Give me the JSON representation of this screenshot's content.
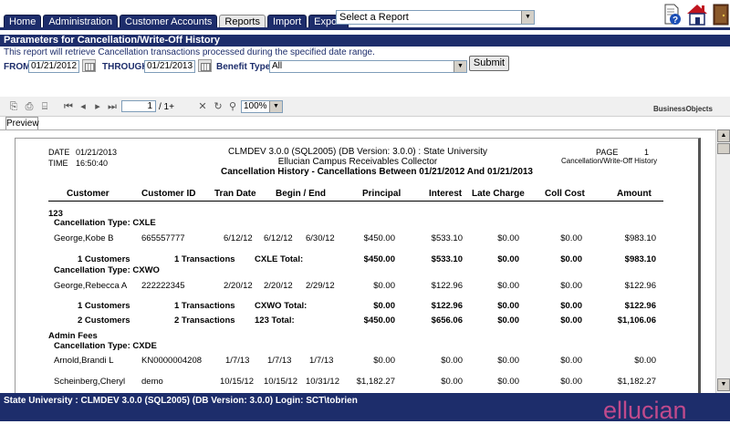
{
  "tabs": [
    "Home",
    "Administration",
    "Customer Accounts",
    "Reports",
    "Import",
    "Export"
  ],
  "active_tab": "Reports",
  "report_select": {
    "value": "Select a Report"
  },
  "icons": {
    "help": "help-icon",
    "home": "home-icon",
    "exit": "exit-door-icon"
  },
  "params": {
    "title": "Parameters for Cancellation/Write-Off History",
    "description": "This report will retrieve Cancellation transactions processed during the specified date range.",
    "from_label": "FROM:",
    "from_value": "01/21/2012",
    "through_label": "THROUGH:",
    "through_value": "01/21/2013",
    "benefit_label": "Benefit Type:",
    "benefit_value": "All",
    "submit": "Submit"
  },
  "viewer": {
    "page_number": "1",
    "page_of": "/ 1+",
    "zoom": "100%",
    "logo": "BusinessObjects",
    "preview_tab": "Preview"
  },
  "report": {
    "date_label": "DATE",
    "date_value": "01/21/2013",
    "time_label": "TIME",
    "time_value": "16:50:40",
    "line1": "CLMDEV 3.0.0 (SQL2005) (DB Version:  3.0.0)  :  State University",
    "line2": "Ellucian Campus Receivables Collector",
    "line3": "Cancellation History - Cancellations Between 01/21/2012 And 01/21/2013",
    "page_label": "PAGE",
    "page_value": "1",
    "report_name": "Cancellation/Write-Off History",
    "columns": [
      "Customer",
      "Customer ID",
      "Tran Date",
      "Begin / End",
      "Principal",
      "Interest",
      "Late Charge",
      "Coll Cost",
      "Amount"
    ],
    "group1": "123",
    "cxle_label": "Cancellation Type:  CXLE",
    "row1": {
      "customer": "George,Kobe B",
      "id": "665557777",
      "tran": "6/12/12",
      "begin": "6/12/12",
      "end": "6/30/12",
      "principal": "$450.00",
      "interest": "$533.10",
      "late": "$0.00",
      "coll": "$0.00",
      "amount": "$983.10"
    },
    "cxle_total": {
      "customers": "1  Customers",
      "transactions": "1  Transactions",
      "label": "CXLE  Total:",
      "principal": "$450.00",
      "interest": "$533.10",
      "late": "$0.00",
      "coll": "$0.00",
      "amount": "$983.10"
    },
    "cxwo_label": "Cancellation Type:  CXWO",
    "row2": {
      "customer": "George,Rebecca A",
      "id": "222222345",
      "tran": "2/20/12",
      "begin": "2/20/12",
      "end": "2/29/12",
      "principal": "$0.00",
      "interest": "$122.96",
      "late": "$0.00",
      "coll": "$0.00",
      "amount": "$122.96"
    },
    "cxwo_total": {
      "customers": "1  Customers",
      "transactions": "1  Transactions",
      "label": "CXWO  Total:",
      "principal": "$0.00",
      "interest": "$122.96",
      "late": "$0.00",
      "coll": "$0.00",
      "amount": "$122.96"
    },
    "group_total": {
      "customers": "2  Customers",
      "transactions": "2  Transactions",
      "label": "123  Total:",
      "principal": "$450.00",
      "interest": "$656.06",
      "late": "$0.00",
      "coll": "$0.00",
      "amount": "$1,106.06"
    },
    "group2": "Admin Fees",
    "cxde_label": "Cancellation Type:  CXDE",
    "row3": {
      "customer": "Arnold,Brandi L",
      "id": "KN0000004208",
      "tran": "1/7/13",
      "begin": "1/7/13",
      "end": "1/7/13",
      "principal": "$0.00",
      "interest": "$0.00",
      "late": "$0.00",
      "coll": "$0.00",
      "amount": "$0.00"
    },
    "row4": {
      "customer": "Scheinberg,Cheryl",
      "id": "demo",
      "tran": "10/15/12",
      "begin": "10/15/12",
      "end": "10/31/12",
      "principal": "$1,182.27",
      "interest": "$0.00",
      "late": "$0.00",
      "coll": "$0.00",
      "amount": "$1,182.27"
    }
  },
  "footer": {
    "text": "State University : CLMDEV 3.0.0 (SQL2005) (DB Version: 3.0.0) Login: SCT\\tobrien",
    "logo": "ellucian"
  }
}
